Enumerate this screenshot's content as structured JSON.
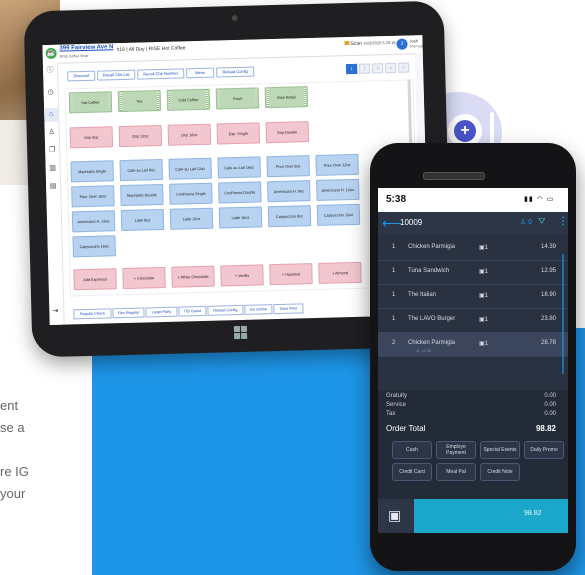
{
  "background": {
    "text_lines": [
      "ent",
      "se a",
      "",
      "re IG",
      "your"
    ]
  },
  "tablet": {
    "store_name": "399 Fairview Ave N",
    "store_sub": "RISE Coffee Shop",
    "title": "#16 | All Day | RISE Hot Coffee",
    "scan_label": "Scan",
    "datetime": "4/23/2020 5:26:16 PM",
    "user_initial": "J",
    "user_name": "Josh",
    "user_role": "Manager",
    "toolbar": [
      "Discount",
      "Recall Chk List",
      "Recall Chk Number",
      "Menu",
      "Reload Config"
    ],
    "pages": [
      "1",
      "2",
      "3",
      "4",
      "5"
    ],
    "tiles": {
      "categories": [
        "Hot Coffee",
        "Tea",
        "Cold Coffee",
        "Food",
        "Rise Retail"
      ],
      "row2": [
        "Drip 8oz",
        "Drip 12oz",
        "Drip 16oz",
        "Esp. Single",
        "Esp Double"
      ],
      "row3": [
        "Machiatto Single",
        "Cafe au Lait 8oz",
        "Cafe au Lait 12oz",
        "Cafe au Lait 16oz",
        "Pour Over 8oz",
        "Pour Over 12oz"
      ],
      "row4": [
        "Pour Over 16oz",
        "Machiatto Double",
        "ConPanna Single",
        "ConPanna Double",
        "Americano H. 8oz",
        "Americano H. 12oz"
      ],
      "row5": [
        "Americano H. 16oz",
        "Latte 8oz",
        "Latte 12oz",
        "Latte 16oz",
        "Cappuccino 8oz",
        "Cappuccino 12oz"
      ],
      "row6": [
        "Cappuccino 16oz"
      ],
      "row7": [
        "Add Espresso",
        "+ Chocolate",
        "+ White Chocolate",
        "+ Vanilla",
        "+ Hazelnut",
        "+ Almond"
      ]
    },
    "bottom_bar": [
      "Regular Check",
      "Flex Regular",
      "Large Party",
      "ITB Guest",
      "Reload Config",
      "Go Online",
      "Save Print"
    ]
  },
  "phone": {
    "time": "5:38",
    "order_number": "10009",
    "guests": "0",
    "items": [
      {
        "n": "1",
        "name": "Chicken Parmigia",
        "qty": "1",
        "price": "14.39"
      },
      {
        "n": "1",
        "name": "Tuna Sandwich",
        "qty": "1",
        "price": "12.95"
      },
      {
        "n": "1",
        "name": "The Italian",
        "qty": "1",
        "price": "18.90"
      },
      {
        "n": "1",
        "name": "The LAVO Burger",
        "qty": "1",
        "price": "23.80"
      },
      {
        "n": "2",
        "name": "Chicken Parmigia",
        "qty": "1",
        "price": "28.78",
        "sub": "@ 14.39"
      }
    ],
    "totals": {
      "gratuity_label": "Gratuity",
      "gratuity": "0.00",
      "service_label": "Service",
      "service": "0.00",
      "tax_label": "Tax",
      "tax": "0.00",
      "order_total_label": "Order Total",
      "order_total": "98.82"
    },
    "payments": [
      "Cash",
      "Employe Payment",
      "Special Events",
      "Daily Promo",
      "Credit Card",
      "Meal Pal",
      "Credit Note"
    ],
    "pay_total": "98.82"
  },
  "colors": {
    "accent_blue": "#1e96e8",
    "tile_green": "#bcd8b6",
    "tile_red": "#f3c7cf",
    "tile_blue": "#b7d3f1",
    "phone_bg": "#232a38"
  }
}
